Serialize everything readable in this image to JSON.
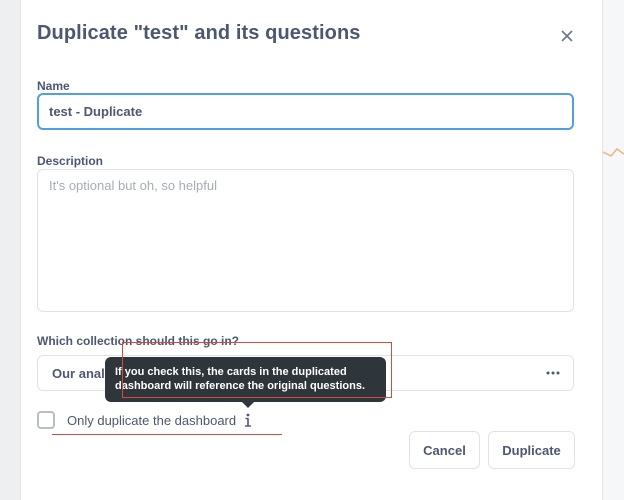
{
  "dialog": {
    "title": "Duplicate \"test\" and its questions",
    "close_icon": "close-icon"
  },
  "form": {
    "name_label": "Name",
    "name_value": "test - Duplicate",
    "description_label": "Description",
    "description_placeholder": "It's optional but oh, so helpful",
    "description_value": "",
    "collection_label": "Which collection should this go in?",
    "collection_value": "Our analytics",
    "collection_menu_icon": "more-dots-icon",
    "checkbox_label": "Only duplicate the dashboard",
    "checkbox_checked": false,
    "info_icon": "info-icon"
  },
  "tooltip": {
    "text": "If you check this, the cards in the duplicated dashboard will reference the original questions."
  },
  "buttons": {
    "cancel": "Cancel",
    "duplicate": "Duplicate"
  },
  "colors": {
    "text": "#4c5773",
    "focus_border": "#509ee3",
    "tooltip_bg": "#2e353b",
    "annotation": "#d64b3a"
  }
}
